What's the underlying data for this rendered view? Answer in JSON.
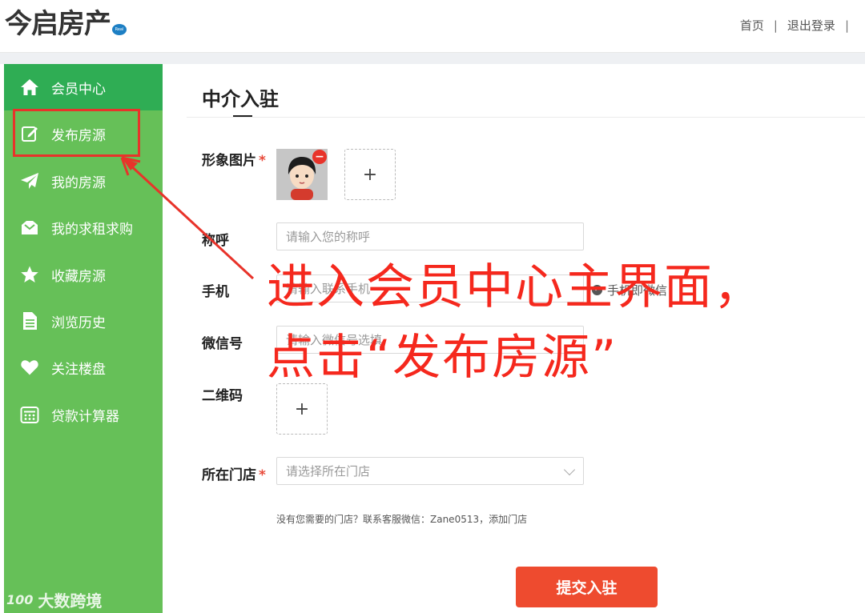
{
  "header": {
    "logo_text": "今启房产",
    "logo_badge": "Real Estate",
    "nav": {
      "home": "首页",
      "logout": "退出登录",
      "sep1": "|",
      "sep2": "|"
    }
  },
  "sidebar": {
    "items": [
      {
        "label": "会员中心",
        "icon": "home-icon"
      },
      {
        "label": "发布房源",
        "icon": "edit-icon"
      },
      {
        "label": "我的房源",
        "icon": "paper-plane-icon"
      },
      {
        "label": "我的求租求购",
        "icon": "inbox-icon"
      },
      {
        "label": "收藏房源",
        "icon": "star-icon"
      },
      {
        "label": "浏览历史",
        "icon": "document-icon"
      },
      {
        "label": "关注楼盘",
        "icon": "heart-icon"
      },
      {
        "label": "贷款计算器",
        "icon": "calculator-icon"
      }
    ],
    "watermark": "大数跨境",
    "watermark_logo": "100"
  },
  "main": {
    "title": "中介入驻",
    "fields": {
      "image_label": "形象图片",
      "name_label": "称呼",
      "name_placeholder": "请输入您的称呼",
      "phone_label": "手机",
      "phone_placeholder": "请输入联系手机",
      "wechat_same_label": "手机即微信",
      "wechat_label": "微信号",
      "wechat_placeholder": "请输入微信号选填",
      "qrcode_label": "二维码",
      "store_label": "所在门店",
      "store_placeholder": "请选择所在门店",
      "required_mark": "*",
      "upload_plus": "+"
    },
    "hint": "没有您需要的门店？联系客服微信：Zane0513，添加门店",
    "submit_label": "提交入驻"
  },
  "annotation": {
    "line1": "进入会员中心主界面，",
    "line2": "点击“发布房源”"
  },
  "colors": {
    "sidebar_bg": "#66c058",
    "sidebar_active": "#2fad54",
    "submit": "#ee4b2f",
    "annotation": "#f5281d",
    "logo_blue": "#1d7fc4"
  }
}
